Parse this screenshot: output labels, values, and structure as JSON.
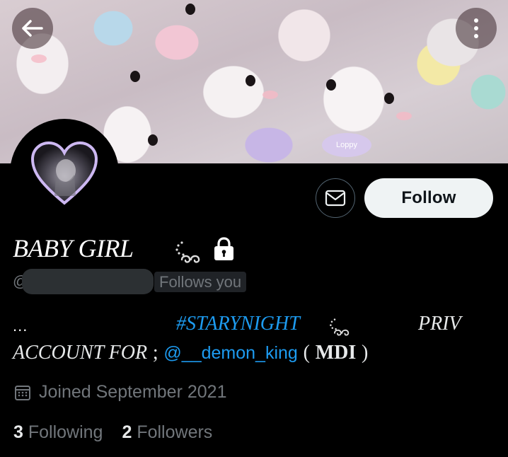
{
  "profile": {
    "display_name": "BABY GIRL",
    "handle_prefix": "@",
    "follows_you": "Follows you",
    "banner_tag": "Loppy",
    "bio": {
      "dots": "...",
      "hashtag": "#STARYNIGHT",
      "priv": "PRIV",
      "account_for": "ACCOUNT FOR",
      "semicolon": ";",
      "mention": "@__demon_king",
      "paren_open": "(",
      "mdi": "MDI",
      "paren_close": ")"
    },
    "joined": "Joined September 2021",
    "following_count": "3",
    "following_label": "Following",
    "followers_count": "2",
    "followers_label": "Followers"
  },
  "buttons": {
    "follow_label": "Follow"
  },
  "icons": {
    "back": "arrow-left-icon",
    "more": "more-vertical-icon",
    "message": "envelope-icon",
    "lock": "lock-icon",
    "calendar": "calendar-icon"
  },
  "colors": {
    "background": "#000000",
    "accent_link": "#1d9bf0",
    "muted_text": "#71767b",
    "follow_button_bg": "#eff3f4",
    "avatar_heart_border": "#cdb8f2"
  }
}
